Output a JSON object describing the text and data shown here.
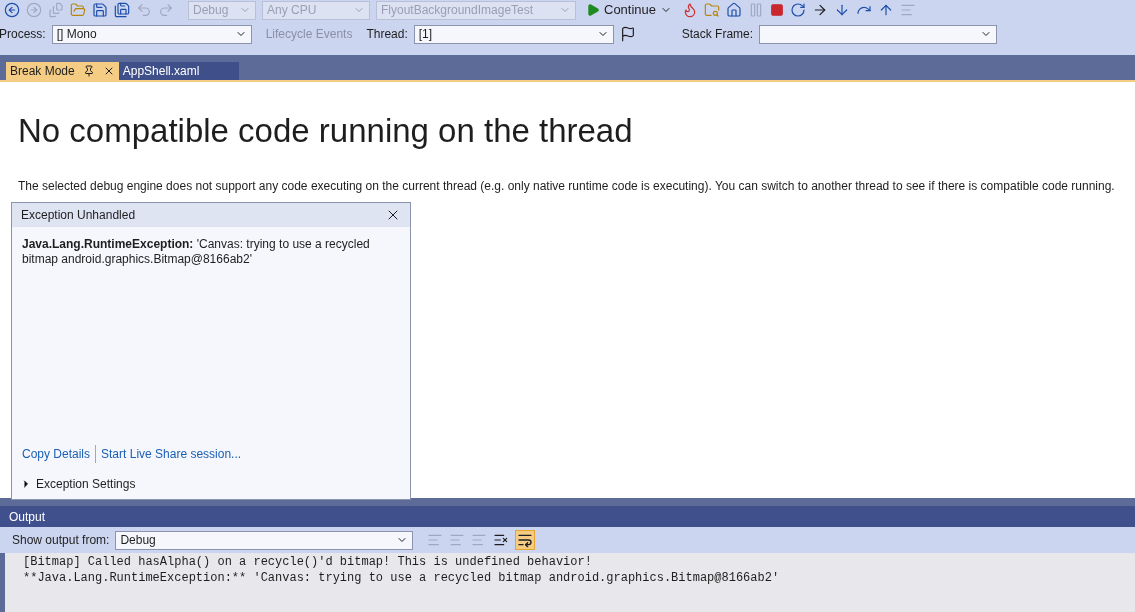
{
  "toolbar": {
    "configuration": "Debug",
    "platform": "Any CPU",
    "startup_project": "FlyoutBackgroundImageTest",
    "continue_button": "Continue"
  },
  "debug_location": {
    "process_label": "Process:",
    "process": "[] Mono",
    "lifecycle_events": "Lifecycle Events",
    "thread_label": "Thread:",
    "thread": "[1]",
    "stack_frame_label": "Stack Frame:"
  },
  "tabs": [
    {
      "label": "Break Mode",
      "selected": true
    },
    {
      "label": "AppShell.xaml",
      "selected": false
    }
  ],
  "break_mode": {
    "heading": "No compatible code running on the thread",
    "description": "The selected debug engine does not support any code executing on the current thread (e.g. only native runtime code is executing). You can switch to another thread to see if there is compatible code running."
  },
  "exception_popup": {
    "title": "Exception Unhandled",
    "exception_type": "Java.Lang.RuntimeException:",
    "message": "'Canvas: trying to use a recycled bitmap android.graphics.Bitmap@8166ab2'",
    "links": [
      "Copy Details",
      "Start Live Share session..."
    ],
    "settings": {
      "label": "Exception Settings",
      "expanded": false
    }
  },
  "output": {
    "title": "Output",
    "show_from_label": "Show output from:",
    "source": "Debug",
    "word_wrap_on": true,
    "lines": [
      "[Bitmap] Called hasAlpha() on a recycle()'d bitmap! This is undefined behavior!",
      "**Java.Lang.RuntimeException:** 'Canvas: trying to use a recycled bitmap android.graphics.Bitmap@8166ab2'"
    ]
  }
}
